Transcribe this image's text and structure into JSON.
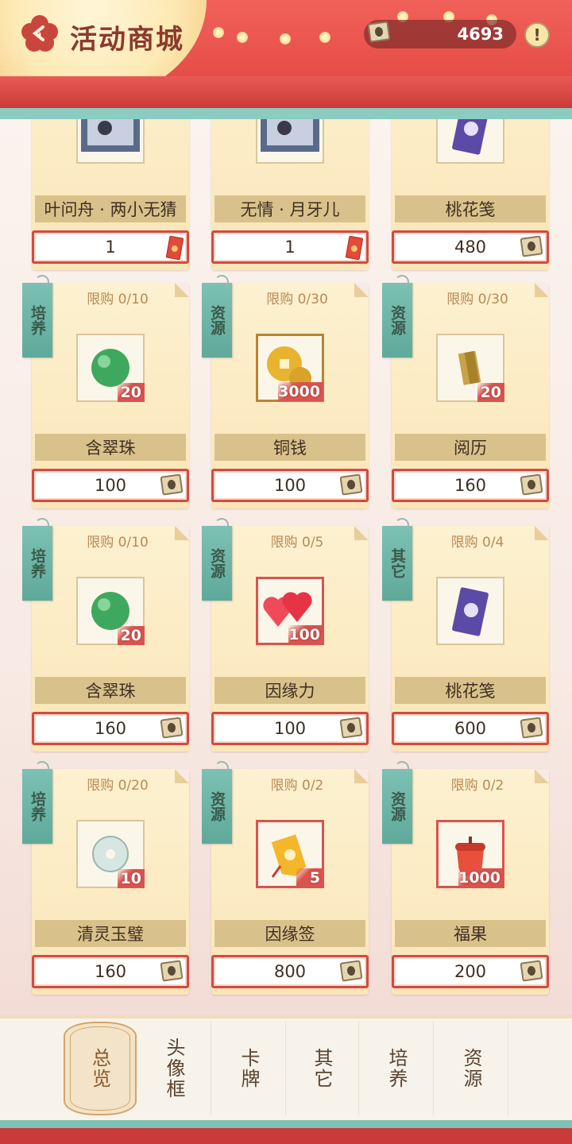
{
  "header": {
    "title": "活动商城",
    "currency_amount": "4693",
    "info_label": "!"
  },
  "items": [
    {
      "name": "叶问舟 · 两小无猜",
      "price": "1",
      "price_icon": "ticket-icon",
      "image": "card-art",
      "tag": "",
      "limit": ""
    },
    {
      "name": "无情 · 月牙儿",
      "price": "1",
      "price_icon": "ticket-icon",
      "image": "card-art",
      "tag": "",
      "limit": ""
    },
    {
      "name": "桃花笺",
      "price": "480",
      "price_icon": "coin-icon",
      "image": "peach-note",
      "tag": "",
      "limit": ""
    },
    {
      "name": "含翠珠",
      "price": "100",
      "price_icon": "coin-icon",
      "image": "jade-bead",
      "tag": "培养",
      "limit": "限购 0/10",
      "count": "20"
    },
    {
      "name": "铜钱",
      "price": "100",
      "price_icon": "coin-icon",
      "image": "copper-coin",
      "tag": "资源",
      "limit": "限购 0/30",
      "count": "3000"
    },
    {
      "name": "阅历",
      "price": "160",
      "price_icon": "coin-icon",
      "image": "experience",
      "tag": "资源",
      "limit": "限购 0/30",
      "count": "20"
    },
    {
      "name": "含翠珠",
      "price": "160",
      "price_icon": "coin-icon",
      "image": "jade-bead",
      "tag": "培养",
      "limit": "限购 0/10",
      "count": "20"
    },
    {
      "name": "因缘力",
      "price": "100",
      "price_icon": "coin-icon",
      "image": "hearts",
      "tag": "资源",
      "limit": "限购 0/5",
      "count": "100"
    },
    {
      "name": "桃花笺",
      "price": "600",
      "price_icon": "coin-icon",
      "image": "peach-note",
      "tag": "其它",
      "limit": "限购 0/4",
      "count": ""
    },
    {
      "name": "清灵玉璧",
      "price": "160",
      "price_icon": "coin-icon",
      "image": "jade-disc",
      "tag": "培养",
      "limit": "限购 0/20",
      "count": "10"
    },
    {
      "name": "因缘签",
      "price": "800",
      "price_icon": "coin-icon",
      "image": "fate-charm",
      "tag": "资源",
      "limit": "限购 0/2",
      "count": "5"
    },
    {
      "name": "福果",
      "price": "200",
      "price_icon": "coin-icon",
      "image": "acorn",
      "tag": "资源",
      "limit": "限购 0/2",
      "count": "1000"
    }
  ],
  "tabs": [
    "总览",
    "头像框",
    "卡牌",
    "其它",
    "培养",
    "资源"
  ],
  "colors": {
    "accent_red": "#d44a40",
    "tag_teal": "#7cc1b4",
    "card_bg": "#fae6b8"
  }
}
